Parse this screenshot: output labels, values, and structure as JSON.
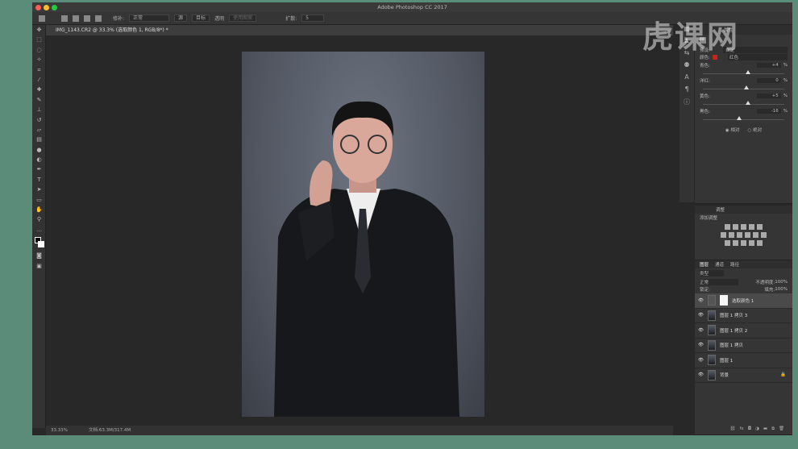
{
  "app": {
    "title": "Adobe Photoshop CC 2017",
    "watermark": "虎课网"
  },
  "options": {
    "mode_label": "修补:",
    "mode_value": "正常",
    "source": "源",
    "target": "目标",
    "transparent": "透明",
    "use_pattern": "使用图案",
    "diffusion_label": "扩散:",
    "diffusion_value": "5"
  },
  "document": {
    "tab": "IMG_1143.CR2 @ 33.3% (选取颜色 1, RGB/8*) *"
  },
  "status": {
    "zoom": "33.33%",
    "doc": "文档:63.3M/317.4M"
  },
  "properties": {
    "tab": "属性",
    "preset_label": "预设:",
    "preset_value": "自定",
    "colors_label": "颜色:",
    "colors_value": "红色",
    "swatch": "#c0281e",
    "sliders": [
      {
        "label": "青色:",
        "value": "+4",
        "unit": "%",
        "pos": 0.52
      },
      {
        "label": "洋红:",
        "value": "0",
        "unit": "%",
        "pos": 0.5
      },
      {
        "label": "黄色:",
        "value": "+5",
        "unit": "%",
        "pos": 0.525
      },
      {
        "label": "黑色:",
        "value": "-16",
        "unit": "%",
        "pos": 0.42
      }
    ],
    "relative": "相对",
    "absolute": "绝对"
  },
  "adjustments": {
    "tab": "调整",
    "add_label": "添加调整"
  },
  "layers": {
    "tabs": [
      "图层",
      "通道",
      "路径"
    ],
    "kind": "类型",
    "blend": "正常",
    "opacity_label": "不透明度:",
    "opacity": "100%",
    "lock_label": "锁定:",
    "fill_label": "填充:",
    "fill": "100%",
    "items": [
      {
        "name": "选取颜色 1"
      },
      {
        "name": "图层 1 拷贝 3"
      },
      {
        "name": "图层 1 拷贝 2"
      },
      {
        "name": "图层 1 拷贝"
      },
      {
        "name": "图层 1"
      },
      {
        "name": "背景"
      }
    ]
  }
}
